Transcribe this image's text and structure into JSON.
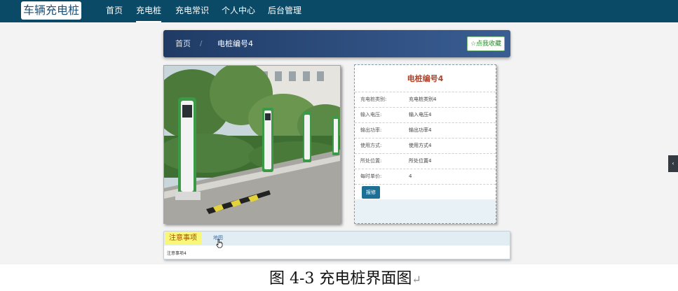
{
  "brand": "车辆充电桩",
  "nav": [
    {
      "label": "首页",
      "active": false
    },
    {
      "label": "充电桩",
      "active": true
    },
    {
      "label": "充电常识",
      "active": false
    },
    {
      "label": "个人中心",
      "active": false
    },
    {
      "label": "后台管理",
      "active": false
    }
  ],
  "breadcrumb": {
    "home": "首页",
    "separator": "/",
    "current": "电桩编号4"
  },
  "favorite_button": "☆点我收藏",
  "detail": {
    "title": "电桩编号4",
    "rows": [
      {
        "label": "充电桩类别:",
        "value": "充电桩类别4"
      },
      {
        "label": "输入电压:",
        "value": "输入电压4"
      },
      {
        "label": "输出功率:",
        "value": "输出功率4"
      },
      {
        "label": "使用方式:",
        "value": "使用方式4"
      },
      {
        "label": "所处位置:",
        "value": "所处位置4"
      },
      {
        "label": "每时单价:",
        "value": "4"
      }
    ],
    "report_button": "报修"
  },
  "notice": {
    "tab_active": "注意事项",
    "tab_other": "地图",
    "content": "注意事项4"
  },
  "side_handle": "‹",
  "caption": "图 4-3 充电桩界面图",
  "caption_mark": "↵",
  "colors": {
    "topbar": "#0b4a66",
    "breadcrumb": "#2a4a7a",
    "title": "#b0432b",
    "report_button": "#1e6f96",
    "notice_tab": "#f8f77a"
  }
}
